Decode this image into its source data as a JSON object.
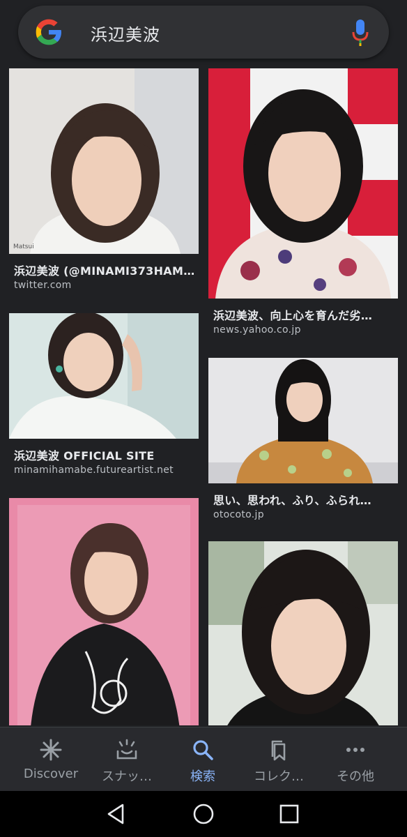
{
  "search": {
    "query": "浜辺美波"
  },
  "results": [
    {
      "title": "浜辺美波 (@MINAMI373HAM…",
      "source": "twitter.com",
      "watermark": "Matsui"
    },
    {
      "title": "浜辺美波、向上心を育んだ劣…",
      "source": "news.yahoo.co.jp"
    },
    {
      "title": "浜辺美波 OFFICIAL SITE",
      "source": "minamihamabe.futureartist.net"
    },
    {
      "title": "思い、思われ、ふり、ふられ…",
      "source": "otocoto.jp"
    },
    {
      "title": "",
      "source": ""
    },
    {
      "title": "",
      "source": ""
    }
  ],
  "nav": {
    "items": [
      {
        "label": "Discover",
        "icon": "asterisk-icon"
      },
      {
        "label": "スナッ…",
        "icon": "snapshot-icon"
      },
      {
        "label": "検索",
        "icon": "search-icon",
        "active": true
      },
      {
        "label": "コレク…",
        "icon": "collections-icon"
      },
      {
        "label": "その他",
        "icon": "more-icon"
      }
    ]
  },
  "colors": {
    "background": "#202124",
    "accent": "#8ab4f8",
    "nav_inactive": "#9aa0a6"
  }
}
